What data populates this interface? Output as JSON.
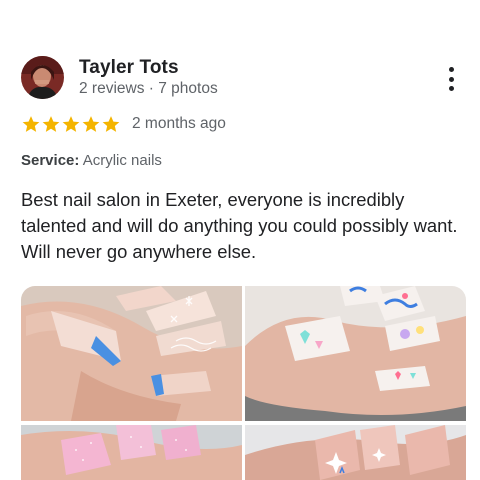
{
  "reviewer": {
    "name": "Tayler Tots",
    "meta": "2 reviews · 7 photos",
    "avatar_icon": "profile-photo"
  },
  "rating": {
    "stars": 5,
    "max": 5,
    "star_color": "#F4B400",
    "date": "2 months ago"
  },
  "service": {
    "label": "Service:",
    "value": "Acrylic nails"
  },
  "review_text": "Best nail salon in Exeter, everyone is incredibly talented and will do anything you could possibly want. Will never go anywhere else.",
  "menu": {
    "icon": "more-vert-icon"
  },
  "photos": [
    {
      "icon": "nail-photo-french-tips-snowflakes"
    },
    {
      "icon": "nail-photo-pastel-abstract-stars"
    },
    {
      "icon": "nail-photo-pink-glitter"
    },
    {
      "icon": "nail-photo-nude-star-art"
    }
  ]
}
